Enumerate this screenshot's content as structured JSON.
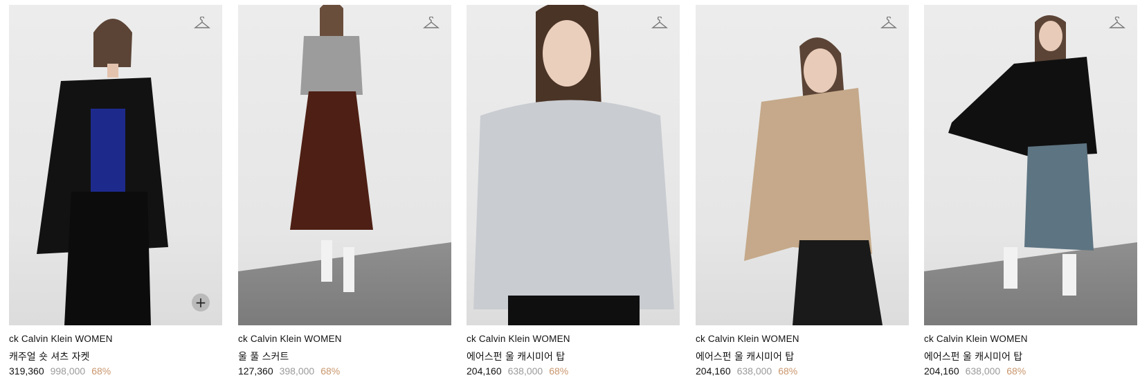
{
  "products": [
    {
      "brand": "ck Calvin Klein WOMEN",
      "name": "캐주얼 숏 셔츠 자켓",
      "price": "319,360",
      "original_price": "998,000",
      "discount": "68%",
      "icon": "hanger-icon",
      "zoom_label": "+"
    },
    {
      "brand": "ck Calvin Klein WOMEN",
      "name": "울 풀 스커트",
      "price": "127,360",
      "original_price": "398,000",
      "discount": "68%",
      "icon": "hanger-icon"
    },
    {
      "brand": "ck Calvin Klein WOMEN",
      "name": "에어스펀 울 캐시미어 탑",
      "price": "204,160",
      "original_price": "638,000",
      "discount": "68%",
      "icon": "hanger-icon"
    },
    {
      "brand": "ck Calvin Klein WOMEN",
      "name": "에어스펀 울 캐시미어 탑",
      "price": "204,160",
      "original_price": "638,000",
      "discount": "68%",
      "icon": "hanger-icon"
    },
    {
      "brand": "ck Calvin Klein WOMEN",
      "name": "에어스펀 울 캐시미어 탑",
      "price": "204,160",
      "original_price": "638,000",
      "discount": "68%",
      "icon": "hanger-icon"
    }
  ],
  "colors": {
    "discount": "#c9966d",
    "original_price": "#9a9a9a",
    "text": "#111111"
  }
}
